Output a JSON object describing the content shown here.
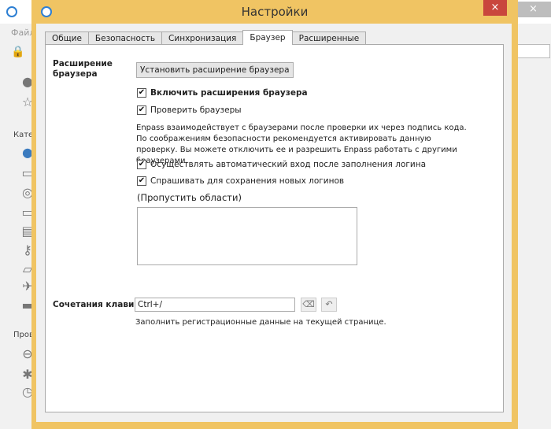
{
  "background_app": {
    "menu_label": "Файл",
    "categories_label": "Катег",
    "audit_label": "Пров",
    "close_icon": "close-icon",
    "search_placeholder": ""
  },
  "dialog": {
    "title": "Настройки",
    "close_label": "×",
    "tabs": [
      {
        "label": "Общие"
      },
      {
        "label": "Безопасность"
      },
      {
        "label": "Синхронизация"
      },
      {
        "label": "Браузер",
        "active": true
      },
      {
        "label": "Расширенные"
      }
    ],
    "browser": {
      "extension_section_label": "Расширение браузера",
      "install_button": "Установить расширение браузера",
      "enable_extensions": {
        "label": "Включить расширения браузера",
        "checked": true
      },
      "verify_browsers": {
        "label": "Проверить браузеры",
        "checked": true
      },
      "verify_description": "Enpass взаимодействует с браузерами после проверки их через подпись кода. По соображениям безопасности рекомендуется активировать данную проверку. Вы можете отключить ее и разрешить Enpass работать с другими браузерами.",
      "auto_submit": {
        "label": "Осуществлять автоматический вход после заполнения логина",
        "checked": true
      },
      "ask_save": {
        "label": "Спрашивать для сохранения новых логинов",
        "checked": true
      },
      "skip_areas_label": "(Пропустить области)",
      "skip_areas_value": "",
      "shortcut_label": "Сочетания клавиш",
      "shortcut_value": "Ctrl+/",
      "shortcut_description": "Заполнить регистрационные данные на текущей странице."
    }
  },
  "colors": {
    "titlebar": "#f0c463",
    "close": "#c9463d",
    "accent": "#2d7fd3"
  }
}
